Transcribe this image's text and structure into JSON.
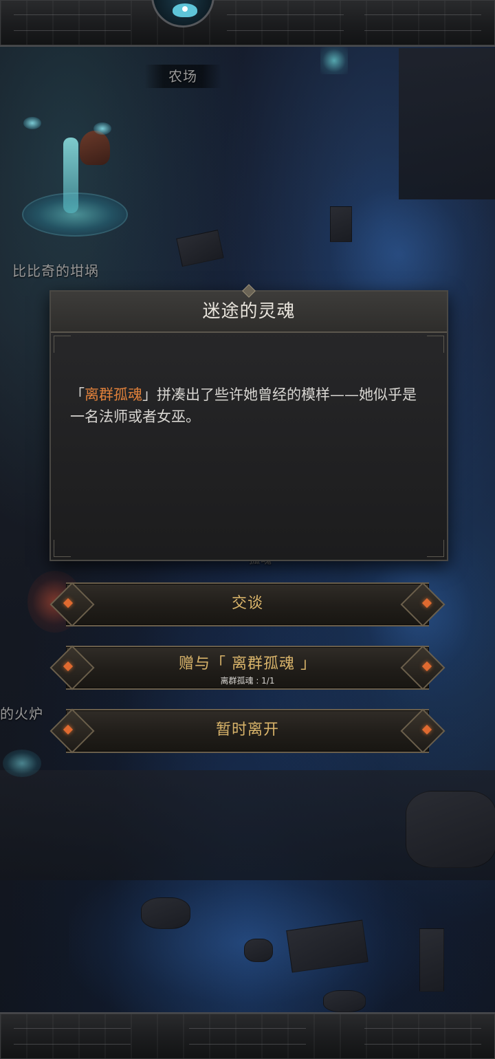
{
  "map": {
    "labels": {
      "farm": "农场",
      "bibiqi": "比比奇的坩埚",
      "furnace": "的火炉",
      "hidden_soul": "孤魂"
    }
  },
  "dialog": {
    "title": "迷途的灵魂",
    "text_prefix": "「",
    "text_highlight": "离群孤魂",
    "text_body": "」拼凑出了些许她曾经的模样——她似乎是一名法师或者女巫。",
    "highlight_color": "#e0803a"
  },
  "options": {
    "talk": {
      "label": "交谈"
    },
    "gift": {
      "label": "赠与「 离群孤魂 」",
      "sublabel": "离群孤魂 : 1/1"
    },
    "leave": {
      "label": "暂时离开"
    }
  },
  "colors": {
    "option_label": "#d9b46a",
    "dialog_text": "#d8d6d2",
    "accent_gem": "#e06a30"
  }
}
